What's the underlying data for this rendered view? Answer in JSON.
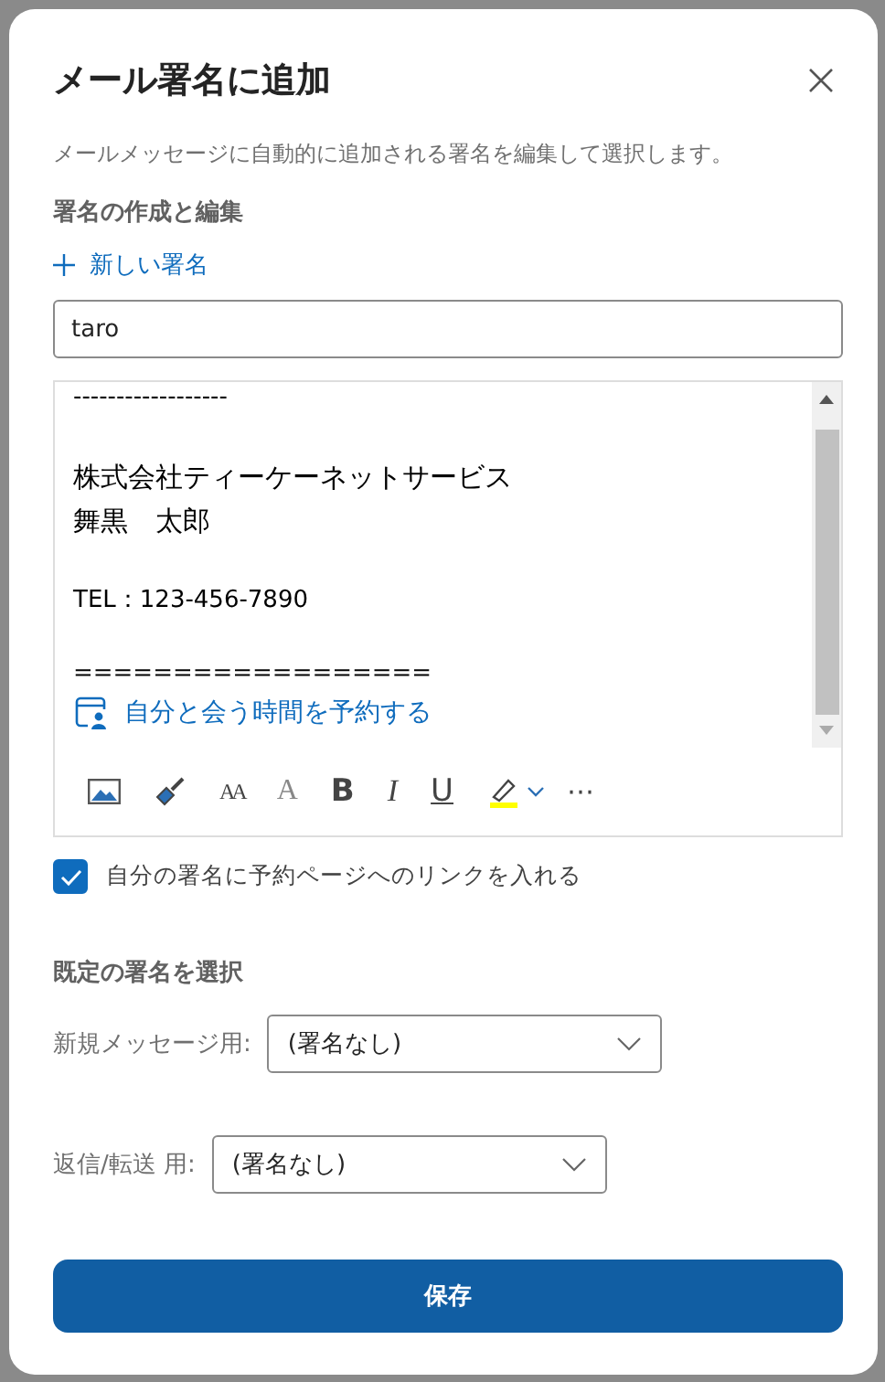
{
  "dialog": {
    "title": "メール署名に追加",
    "description": "メールメッセージに自動的に追加される署名を編集して選択します。",
    "create_heading": "署名の作成と編集",
    "new_signature": "新しい署名",
    "name_field": {
      "value": "taro"
    },
    "editor": {
      "lines": [
        {
          "kind": "text",
          "text": "------------------"
        },
        {
          "kind": "blank"
        },
        {
          "kind": "large",
          "text": "株式会社ティーケーネットサービス"
        },
        {
          "kind": "large",
          "text": "舞黒　太郎"
        },
        {
          "kind": "blank"
        },
        {
          "kind": "text",
          "text": "TEL：123-456-7890"
        },
        {
          "kind": "blank"
        },
        {
          "kind": "text",
          "text": "=================="
        },
        {
          "kind": "link",
          "text": "自分と会う時間を予約する"
        }
      ],
      "toolbar": [
        {
          "kind": "image"
        },
        {
          "kind": "paint"
        },
        {
          "kind": "size",
          "glyph": "AA"
        },
        {
          "kind": "grow",
          "glyph": "A"
        },
        {
          "kind": "bold",
          "glyph": "B"
        },
        {
          "kind": "italic",
          "glyph": "I"
        },
        {
          "kind": "underline",
          "glyph": "U"
        },
        {
          "kind": "highlight"
        },
        {
          "kind": "more",
          "glyph": "⋯"
        }
      ]
    },
    "booking_checkbox": {
      "label": "自分の署名に予約ページへのリンクを入れる",
      "checked": true
    },
    "defaults_heading": "既定の署名を選択",
    "defaults": [
      {
        "label": "新規メッセージ用:",
        "value": "(署名なし)"
      },
      {
        "label": "返信/転送 用:",
        "value": "(署名なし)"
      }
    ],
    "save_button": "保存"
  }
}
